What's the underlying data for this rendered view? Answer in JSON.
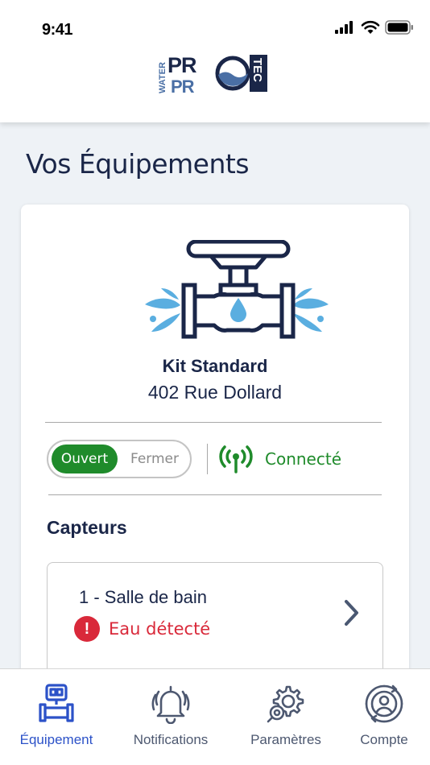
{
  "status_bar": {
    "time": "9:41"
  },
  "header": {
    "logo_alt": "WATER PRO TEC"
  },
  "page": {
    "title": "Vos Équipements"
  },
  "equipment": {
    "name": "Kit Standard",
    "address": "402 Rue Dollard",
    "valve_toggle": {
      "on_label": "Ouvert",
      "off_label": "Fermer",
      "selected": "Ouvert"
    },
    "connection_status": "Connecté"
  },
  "sensors": {
    "heading": "Capteurs",
    "items": [
      {
        "name": "1 - Salle de bain",
        "status": "Eau détecté",
        "alert_icon": "exclamation-alert-icon"
      }
    ]
  },
  "nav": {
    "items": [
      {
        "label": "Équipement",
        "icon": "equipment-icon",
        "active": true
      },
      {
        "label": "Notifications",
        "icon": "bell-icon",
        "active": false
      },
      {
        "label": "Paramètres",
        "icon": "gears-icon",
        "active": false
      },
      {
        "label": "Compte",
        "icon": "account-icon",
        "active": false
      }
    ]
  },
  "colors": {
    "brand_navy": "#1a2648",
    "success_green": "#1f8b2b",
    "alert_red": "#d9293a",
    "active_blue": "#2c52c8",
    "water_blue": "#5aaee0"
  }
}
